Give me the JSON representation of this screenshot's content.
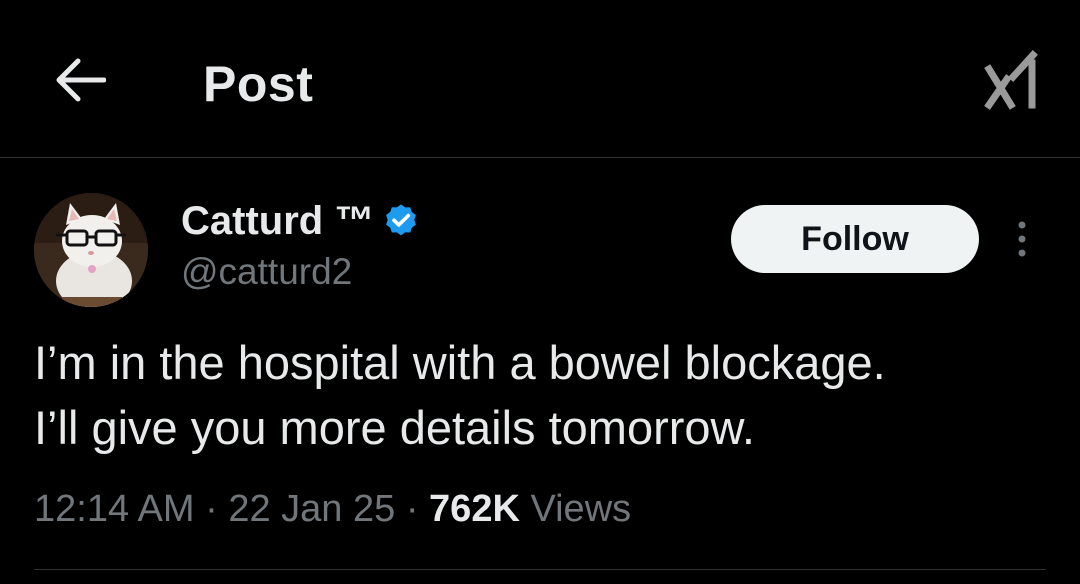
{
  "header": {
    "title": "Post",
    "back_icon": "arrow-left-icon",
    "grok_icon": "grok-icon"
  },
  "author": {
    "name": "Catturd ™",
    "handle": "@catturd2",
    "verified": true,
    "verified_color": "#1d9bf0",
    "follow_label": "Follow",
    "more_icon": "more-vertical-icon"
  },
  "tweet": {
    "text": "I’m in the hospital with a bowel blockage.\nI’ll give you more details tomorrow.",
    "time": "12:14 AM",
    "separator": "·",
    "date": "22 Jan 25",
    "views_count": "762K",
    "views_label": "Views"
  },
  "colors": {
    "background": "#000000",
    "primary_text": "#e7e9ea",
    "secondary_text": "#71767b",
    "divider": "#2f3336"
  }
}
